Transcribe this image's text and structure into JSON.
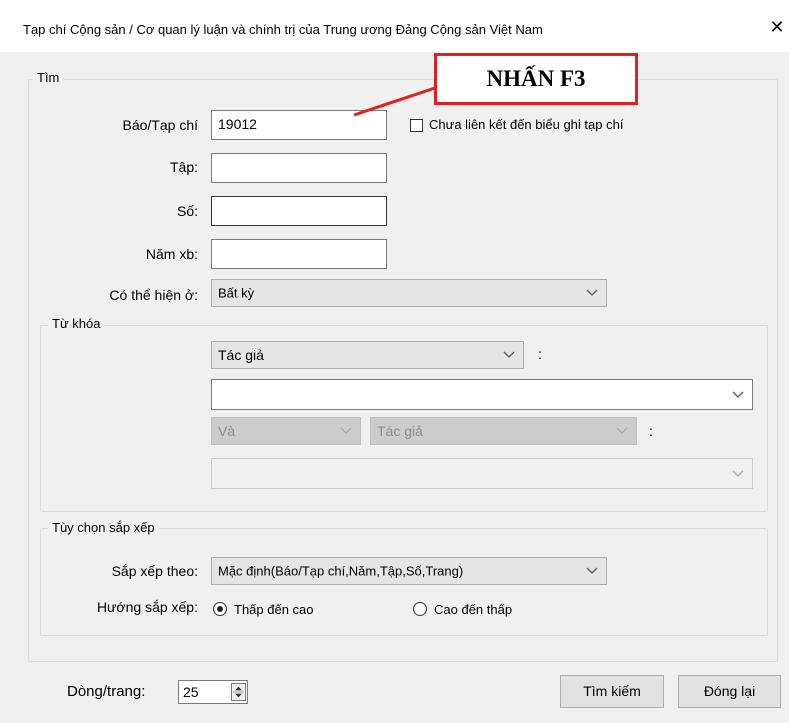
{
  "window": {
    "title": "Tạp chí Cộng sản /  Cơ quan lý luận và chính trị của Trung ương Đảng Cộng sản Việt Nam",
    "close_glyph": "✕"
  },
  "callout": {
    "text": "NHẤN F3",
    "color": "#e02020"
  },
  "search_group": {
    "caption": "Tìm",
    "journal_label": "Báo/Tạp chí",
    "journal_value": "19012",
    "unlinked_checkbox_label": "Chưa liên kết đến biểu ghi tạp chí",
    "unlinked_checked": false,
    "volume_label": "Tập:",
    "volume_value": "",
    "issue_label": "Số:",
    "issue_value": "",
    "year_label": "Năm xb:",
    "year_value": "",
    "location_label": "Có thể hiện ở:",
    "location_value": "Bất kỳ"
  },
  "keyword_group": {
    "caption": "Từ khóa",
    "field1_value": "Tác giả",
    "colon": ":",
    "term1_value": "",
    "operator_value": "Và",
    "field2_value": "Tác giả",
    "term2_value": ""
  },
  "sort_group": {
    "caption": "Tùy chọn sắp xếp",
    "sort_by_label": "Sắp xếp theo:",
    "sort_by_value": "Mặc định(Báo/Tạp chí,Năm,Tập,Số,Trang)",
    "direction_label": "Hướng sắp xếp:",
    "asc_label": "Thấp đến cao",
    "desc_label": "Cao đến thấp",
    "selected_direction": "asc"
  },
  "footer": {
    "rows_label": "Dòng/trang:",
    "rows_value": "25",
    "search_button": "Tìm kiếm",
    "close_button": "Đóng lại"
  }
}
